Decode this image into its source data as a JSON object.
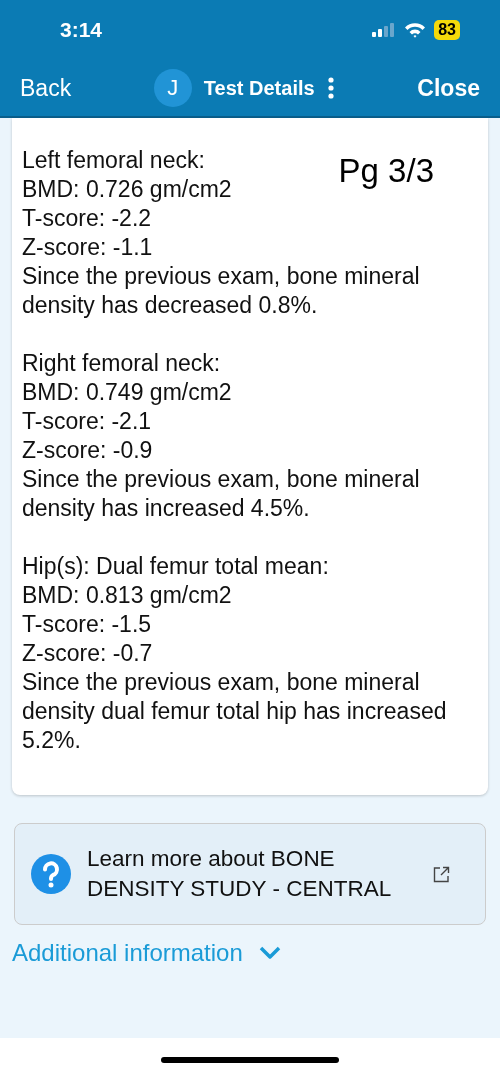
{
  "status_bar": {
    "time": "3:14",
    "battery": "83"
  },
  "nav": {
    "back": "Back",
    "avatar": "J",
    "title": "Test Details",
    "close": "Close"
  },
  "report": {
    "page": "Pg 3/3",
    "sections": [
      {
        "heading": "Left femoral neck:",
        "lines": [
          "BMD: 0.726 gm/cm2",
          "T-score: -2.2",
          "Z-score: -1.1"
        ],
        "note": "Since the previous exam, bone mineral density has decreased 0.8%."
      },
      {
        "heading": "Right femoral neck:",
        "lines": [
          "BMD: 0.749 gm/cm2",
          "T-score: -2.1",
          "Z-score: -0.9"
        ],
        "note": "Since the previous exam, bone mineral density has increased 4.5%."
      },
      {
        "heading": "Hip(s): Dual femur total mean:",
        "lines": [
          "BMD: 0.813 gm/cm2",
          "T-score: -1.5",
          "Z-score: -0.7"
        ],
        "note": "Since the previous exam, bone mineral density dual femur total hip has increased 5.2%."
      }
    ]
  },
  "learn_more": {
    "text": "Learn more about BONE DENSITY STUDY - CENTRAL"
  },
  "additional": {
    "label": "Additional information",
    "expanded": false
  }
}
